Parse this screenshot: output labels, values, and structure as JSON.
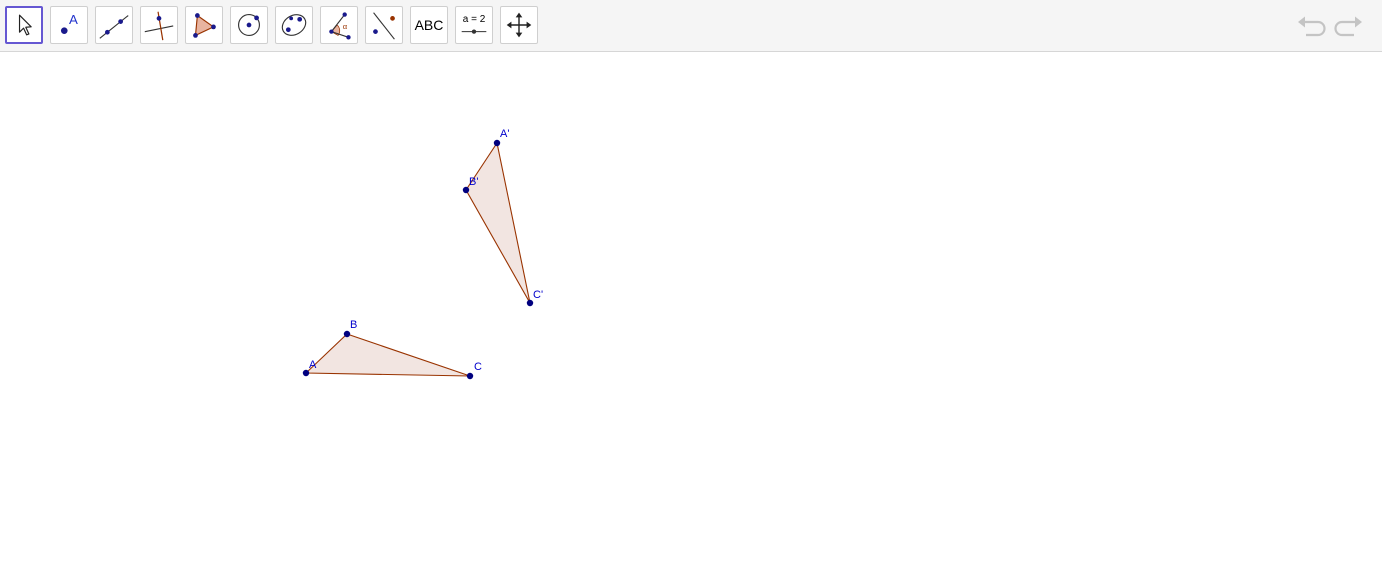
{
  "toolbar": {
    "tools": [
      {
        "name": "move"
      },
      {
        "name": "point",
        "label": "A"
      },
      {
        "name": "line"
      },
      {
        "name": "perpendicular-line"
      },
      {
        "name": "polygon"
      },
      {
        "name": "circle-center-point"
      },
      {
        "name": "ellipse"
      },
      {
        "name": "angle",
        "label": "α"
      },
      {
        "name": "reflect-about-line"
      },
      {
        "name": "text",
        "label": "ABC"
      },
      {
        "name": "slider",
        "label": "a = 2"
      },
      {
        "name": "move-graphics-view"
      }
    ],
    "selected_tool": "move",
    "undo_enabled": false,
    "redo_enabled": false
  },
  "construction": {
    "points": [
      {
        "name": "A",
        "label": "A"
      },
      {
        "name": "B",
        "label": "B"
      },
      {
        "name": "C",
        "label": "C"
      },
      {
        "name": "A'",
        "label": "A'"
      },
      {
        "name": "B'",
        "label": "B'"
      },
      {
        "name": "C'",
        "label": "C'"
      }
    ],
    "polygons": [
      {
        "vertices": [
          "A",
          "B",
          "C"
        ]
      },
      {
        "vertices": [
          "A'",
          "B'",
          "C'"
        ]
      }
    ]
  },
  "colors": {
    "accent": "#6557d2",
    "point": "#00007f",
    "label": "#0000cc",
    "polygon_edge": "#993300",
    "polygon_fill": "#f2e5e1",
    "toolbar_bg": "#f5f5f5"
  }
}
